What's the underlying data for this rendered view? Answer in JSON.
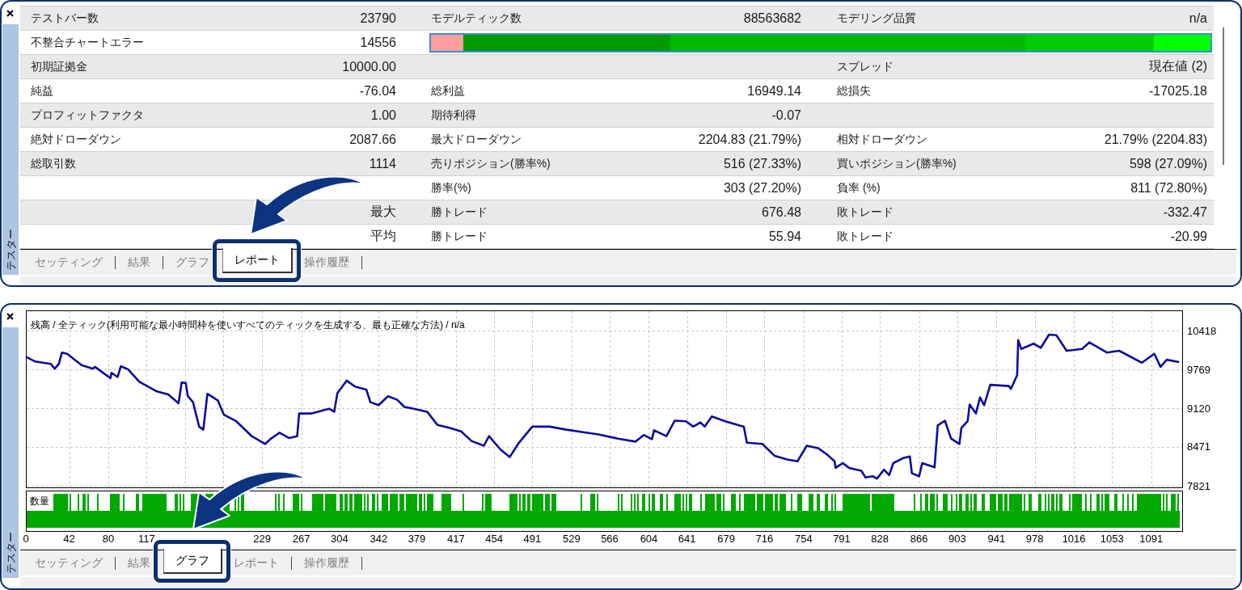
{
  "report_panel": {
    "sidebar_title": "テスター",
    "rows": [
      {
        "kind": "stats",
        "cells": [
          {
            "label": "テストバー数",
            "value": "23790"
          },
          {
            "label": "モデルティック数",
            "value": "88563682"
          },
          {
            "label": "モデリング品質",
            "value": "n/a"
          }
        ]
      },
      {
        "kind": "stats_quality",
        "cells": [
          {
            "label": "不整合チャートエラー",
            "value": "14556"
          }
        ]
      },
      {
        "kind": "stats",
        "cells": [
          {
            "label": "初期証拠金",
            "value": "10000.00"
          },
          null,
          {
            "label": "スプレッド",
            "value": "現在値 (2)"
          }
        ]
      },
      {
        "kind": "stats",
        "cells": [
          {
            "label": "純益",
            "value": "-76.04"
          },
          {
            "label": "総利益",
            "value": "16949.14"
          },
          {
            "label": "総損失",
            "value": "-17025.18"
          }
        ]
      },
      {
        "kind": "stats",
        "cells": [
          {
            "label": "プロフィットファクタ",
            "value": "1.00"
          },
          {
            "label": "期待利得",
            "value": "-0.07"
          },
          null
        ]
      },
      {
        "kind": "stats",
        "cells": [
          {
            "label": "絶対ドローダウン",
            "value": "2087.66"
          },
          {
            "label": "最大ドローダウン",
            "value": "2204.83 (21.79%)"
          },
          {
            "label": "相対ドローダウン",
            "value": "21.79% (2204.83)"
          }
        ]
      },
      {
        "kind": "stats",
        "cells": [
          {
            "label": "総取引数",
            "value": "1114"
          },
          {
            "label": "売りポジション(勝率%)",
            "value": "516 (27.33%)"
          },
          {
            "label": "買いポジション(勝率%)",
            "value": "598 (27.09%)"
          }
        ]
      },
      {
        "kind": "stats",
        "cells": [
          null,
          {
            "label": "勝率(%)",
            "value": "303 (27.20%)"
          },
          {
            "label": "負率 (%)",
            "value": "811 (72.80%)"
          }
        ]
      },
      {
        "kind": "stats",
        "cells": [
          {
            "value": "最大"
          },
          {
            "label": "勝トレード",
            "value": "676.48"
          },
          {
            "label": "敗トレード",
            "value": "-332.47"
          }
        ]
      },
      {
        "kind": "stats",
        "cells": [
          {
            "value": "平均"
          },
          {
            "label": "勝トレード",
            "value": "55.94"
          },
          {
            "label": "敗トレード",
            "value": "-20.99"
          }
        ]
      }
    ],
    "tabs": [
      {
        "label": "セッティング",
        "selected": false
      },
      {
        "label": "結果",
        "selected": false
      },
      {
        "label": "グラフ",
        "selected": false
      },
      {
        "label": "レポート",
        "selected": true
      },
      {
        "label": "操作履歴",
        "selected": false
      }
    ]
  },
  "graph_panel": {
    "sidebar_title": "テスター",
    "chart": {
      "chart_data": {
        "type": "line",
        "title": "残高 / 全ティック(利用可能な最小時間枠を使いすべてのティックを生成する、最も正確な方法) / n/a",
        "grid": true,
        "x": [
          0,
          9,
          24,
          28,
          32,
          35,
          40,
          54,
          65,
          67,
          82,
          83,
          89,
          92,
          99,
          110,
          127,
          138,
          148,
          151,
          155,
          157,
          162,
          168,
          172,
          176,
          186,
          192,
          204,
          219,
          232,
          237,
          246,
          255,
          263,
          265,
          277,
          294,
          299,
          302,
          311,
          319,
          330,
          334,
          342,
          351,
          360,
          367,
          376,
          389,
          399,
          411,
          422,
          432,
          444,
          449,
          460,
          469,
          478,
          491,
          508,
          524,
          539,
          555,
          574,
          591,
          599,
          607,
          609,
          621,
          629,
          640,
          647,
          654,
          658,
          665,
          678,
          696,
          699,
          714,
          726,
          738,
          748,
          757,
          768,
          777,
          784,
          785,
          792,
          798,
          810,
          814,
          821,
          825,
          832,
          837,
          841,
          850,
          857,
          859,
          866,
          869,
          881,
          884,
          891,
          897,
          905,
          907,
          913,
          915,
          921,
          925,
          929,
          935,
          953,
          955,
          961,
          962,
          965,
          977,
          984,
          992,
          999,
          1009,
          1024,
          1031,
          1048,
          1060,
          1082,
          1094,
          1100,
          1106,
          1118
        ],
        "series": [
          {
            "color": "#0c0c9c",
            "values": [
              9980,
              9900,
              9860,
              9780,
              9860,
              10050,
              10030,
              9840,
              9780,
              9810,
              9620,
              9710,
              9640,
              9820,
              9770,
              9560,
              9400,
              9350,
              9200,
              9550,
              9540,
              9320,
              9220,
              8810,
              8760,
              9360,
              9250,
              9010,
              8900,
              8650,
              8520,
              8600,
              8710,
              8620,
              8650,
              9030,
              9030,
              9110,
              9060,
              9370,
              9580,
              9480,
              9430,
              9220,
              9170,
              9320,
              9260,
              9140,
              9110,
              9060,
              8840,
              8790,
              8730,
              8570,
              8490,
              8650,
              8430,
              8300,
              8540,
              8810,
              8810,
              8760,
              8720,
              8680,
              8610,
              8560,
              8670,
              8600,
              8750,
              8650,
              8910,
              8900,
              8810,
              8880,
              8810,
              8980,
              8900,
              8810,
              8540,
              8520,
              8320,
              8260,
              8230,
              8490,
              8450,
              8340,
              8230,
              8120,
              8200,
              8120,
              8070,
              7960,
              7980,
              7940,
              8090,
              8000,
              8200,
              8280,
              8310,
              8030,
              7980,
              8200,
              8130,
              8830,
              8910,
              8610,
              8520,
              8790,
              8900,
              9180,
              9030,
              9300,
              9170,
              9510,
              9490,
              9440,
              9670,
              10260,
              10110,
              10200,
              10130,
              10350,
              10340,
              10080,
              10110,
              10220,
              10050,
              10080,
              9880,
              10030,
              9810,
              9930,
              9890
            ]
          }
        ],
        "xlim": [
          0,
          1121
        ],
        "ylim": [
          7794,
          10756
        ],
        "xticks": [
          0,
          42,
          80,
          117,
          229,
          267,
          304,
          342,
          379,
          417,
          454,
          491,
          529,
          566,
          604,
          641,
          679,
          716,
          754,
          791,
          828,
          866,
          903,
          941,
          978,
          1016,
          1053,
          1091
        ],
        "yticks": [
          7821,
          8471,
          9120,
          9769,
          10418
        ]
      }
    },
    "volume_chart": {
      "label": "数量"
    },
    "tabs": [
      {
        "label": "セッティング",
        "selected": false
      },
      {
        "label": "結果",
        "selected": false
      },
      {
        "label": "グラフ",
        "selected": true
      },
      {
        "label": "レポート",
        "selected": false
      },
      {
        "label": "操作履歴",
        "selected": false
      }
    ]
  }
}
